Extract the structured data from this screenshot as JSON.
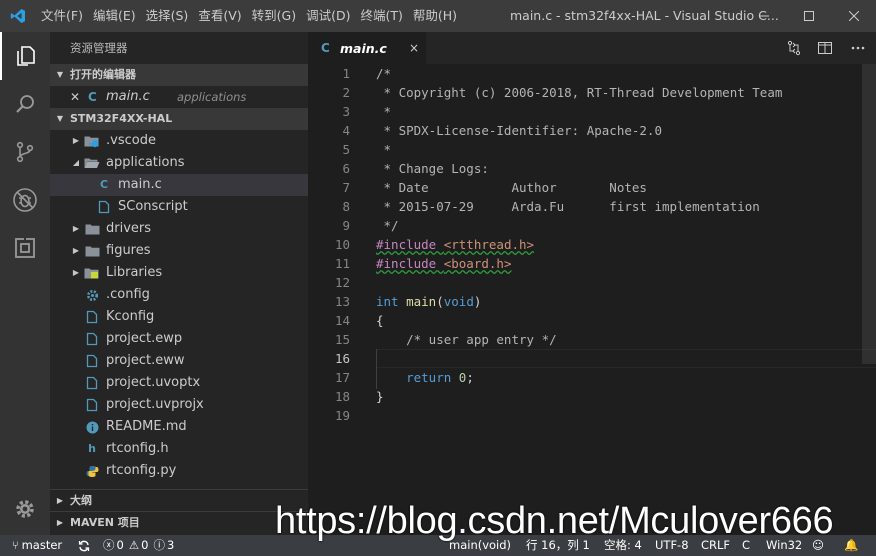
{
  "window": {
    "title": "main.c - stm32f4xx-HAL - Visual Studio C..."
  },
  "menu": [
    "文件(F)",
    "编辑(E)",
    "选择(S)",
    "查看(V)",
    "转到(G)",
    "调试(D)",
    "终端(T)",
    "帮助(H)"
  ],
  "sidebar": {
    "title": "资源管理器",
    "open_editors_header": "打开的编辑器",
    "open_editor": {
      "name": "main.c",
      "folder": "applications"
    },
    "project_header": "STM32F4XX-HAL",
    "tree": [
      {
        "label": ".vscode",
        "kind": "folder",
        "icon": "vscode-folder-icon",
        "depth": 0,
        "expanded": false
      },
      {
        "label": "applications",
        "kind": "folder",
        "icon": "folder-open-icon",
        "depth": 0,
        "expanded": true
      },
      {
        "label": "main.c",
        "kind": "file",
        "icon": "c-file-icon",
        "depth": 1,
        "selected": true
      },
      {
        "label": "SConscript",
        "kind": "file",
        "icon": "file-icon",
        "depth": 1
      },
      {
        "label": "drivers",
        "kind": "folder",
        "icon": "folder-icon",
        "depth": 0,
        "expanded": false
      },
      {
        "label": "figures",
        "kind": "folder",
        "icon": "folder-icon",
        "depth": 0,
        "expanded": false
      },
      {
        "label": "Libraries",
        "kind": "folder",
        "icon": "library-folder-icon",
        "depth": 0,
        "expanded": false
      },
      {
        "label": ".config",
        "kind": "file",
        "icon": "gear-file-icon",
        "depth": 0
      },
      {
        "label": "Kconfig",
        "kind": "file",
        "icon": "file-icon",
        "depth": 0
      },
      {
        "label": "project.ewp",
        "kind": "file",
        "icon": "file-icon",
        "depth": 0
      },
      {
        "label": "project.eww",
        "kind": "file",
        "icon": "file-icon",
        "depth": 0
      },
      {
        "label": "project.uvoptx",
        "kind": "file",
        "icon": "file-icon",
        "depth": 0
      },
      {
        "label": "project.uvprojx",
        "kind": "file",
        "icon": "file-icon",
        "depth": 0
      },
      {
        "label": "README.md",
        "kind": "file",
        "icon": "info-file-icon",
        "depth": 0
      },
      {
        "label": "rtconfig.h",
        "kind": "file",
        "icon": "h-file-icon",
        "depth": 0
      },
      {
        "label": "rtconfig.py",
        "kind": "file",
        "icon": "python-file-icon",
        "depth": 0
      }
    ],
    "outline_header": "大纲",
    "maven_header": "MAVEN 项目"
  },
  "editor": {
    "tab": {
      "label": "main.c",
      "close": "×"
    },
    "lines": [
      [
        {
          "t": "/*",
          "c": "com"
        }
      ],
      [
        {
          "t": " * Copyright (c) 2006-2018, RT-Thread Development Team",
          "c": "com"
        }
      ],
      [
        {
          "t": " *",
          "c": "com"
        }
      ],
      [
        {
          "t": " * SPDX-License-Identifier: Apache-2.0",
          "c": "com"
        }
      ],
      [
        {
          "t": " *",
          "c": "com"
        }
      ],
      [
        {
          "t": " * Change Logs:",
          "c": "com"
        }
      ],
      [
        {
          "t": " * Date           Author       Notes",
          "c": "com"
        }
      ],
      [
        {
          "t": " * 2015-07-29     Arda.Fu      first implementation",
          "c": "com"
        }
      ],
      [
        {
          "t": " */",
          "c": "com"
        }
      ],
      [
        {
          "t": "#include ",
          "c": "pp sq"
        },
        {
          "t": "<rtthread.h>",
          "c": "str sq"
        }
      ],
      [
        {
          "t": "#include ",
          "c": "pp sq"
        },
        {
          "t": "<board.h>",
          "c": "str sq"
        }
      ],
      [
        {
          "t": "",
          "c": ""
        }
      ],
      [
        {
          "t": "int ",
          "c": "kw"
        },
        {
          "t": "main",
          "c": "fn"
        },
        {
          "t": "(",
          "c": ""
        },
        {
          "t": "void",
          "c": "kw"
        },
        {
          "t": ")",
          "c": ""
        }
      ],
      [
        {
          "t": "{",
          "c": ""
        }
      ],
      [
        {
          "t": "    /* user app entry */",
          "c": "com"
        }
      ],
      [
        {
          "t": "",
          "c": ""
        }
      ],
      [
        {
          "t": "    ",
          "c": ""
        },
        {
          "t": "return ",
          "c": "kw"
        },
        {
          "t": "0",
          "c": "num"
        },
        {
          "t": ";",
          "c": ""
        }
      ],
      [
        {
          "t": "}",
          "c": ""
        }
      ],
      [
        {
          "t": "",
          "c": ""
        }
      ]
    ]
  },
  "statusbar": {
    "branch": "master",
    "errors": "0",
    "warnings": "0",
    "info": "3",
    "function": "main(void)",
    "position": "行 16，列 1",
    "spaces": "空格: 4",
    "encoding": "UTF-8",
    "eol": "CRLF",
    "language": "C",
    "platform": "Win32"
  },
  "watermark": "https://blog.csdn.net/Mculover666"
}
